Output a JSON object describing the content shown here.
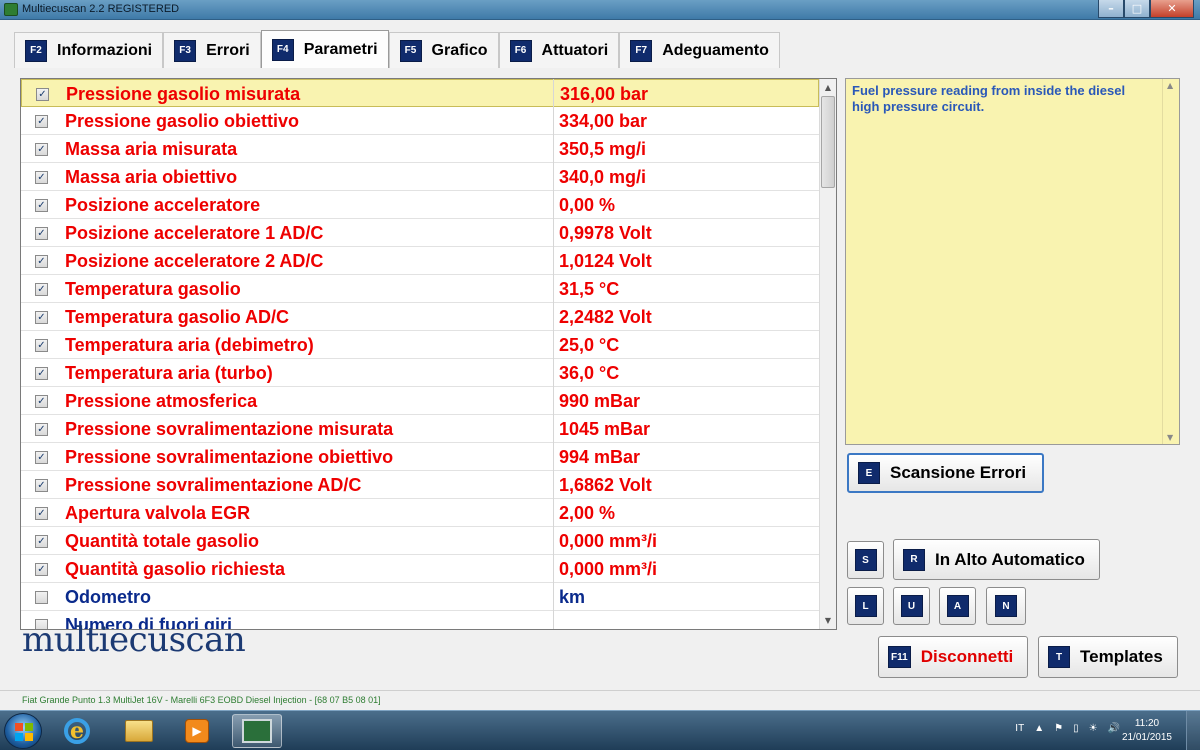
{
  "window": {
    "title": "Multiecuscan 2.2 REGISTERED",
    "controls": {
      "minimize": "–",
      "maximize": "□",
      "close": "✕"
    }
  },
  "tabs": [
    {
      "key": "F2",
      "label": "Informazioni"
    },
    {
      "key": "F3",
      "label": "Errori"
    },
    {
      "key": "F4",
      "label": "Parametri",
      "active": true
    },
    {
      "key": "F5",
      "label": "Grafico"
    },
    {
      "key": "F6",
      "label": "Attuatori"
    },
    {
      "key": "F7",
      "label": "Adeguamento"
    }
  ],
  "parameters": [
    {
      "name": "Pressione gasolio misurata",
      "value": "316,00 bar",
      "checked": true,
      "selected": true
    },
    {
      "name": "Pressione gasolio obiettivo",
      "value": "334,00 bar",
      "checked": true
    },
    {
      "name": "Massa aria misurata",
      "value": "350,5 mg/i",
      "checked": true
    },
    {
      "name": "Massa aria obiettivo",
      "value": "340,0 mg/i",
      "checked": true
    },
    {
      "name": "Posizione acceleratore",
      "value": "0,00 %",
      "checked": true
    },
    {
      "name": "Posizione acceleratore 1 AD/C",
      "value": "0,9978 Volt",
      "checked": true
    },
    {
      "name": "Posizione acceleratore 2 AD/C",
      "value": "1,0124 Volt",
      "checked": true
    },
    {
      "name": "Temperatura gasolio",
      "value": "31,5 °C",
      "checked": true
    },
    {
      "name": "Temperatura gasolio AD/C",
      "value": "2,2482 Volt",
      "checked": true
    },
    {
      "name": "Temperatura aria (debimetro)",
      "value": "25,0 °C",
      "checked": true
    },
    {
      "name": "Temperatura aria (turbo)",
      "value": "36,0 °C",
      "checked": true
    },
    {
      "name": "Pressione atmosferica",
      "value": "990 mBar",
      "checked": true
    },
    {
      "name": "Pressione sovralimentazione misurata",
      "value": "1045 mBar",
      "checked": true
    },
    {
      "name": "Pressione sovralimentazione obiettivo",
      "value": "994 mBar",
      "checked": true
    },
    {
      "name": "Pressione sovralimentazione AD/C",
      "value": "1,6862 Volt",
      "checked": true
    },
    {
      "name": "Apertura valvola EGR",
      "value": "2,00 %",
      "checked": true
    },
    {
      "name": "Quantità totale gasolio",
      "value": "0,000 mm³/i",
      "checked": true
    },
    {
      "name": "Quantità gasolio richiesta",
      "value": "0,000 mm³/i",
      "checked": true
    },
    {
      "name": "Odometro",
      "value": "km",
      "checked": false,
      "color": "blue"
    },
    {
      "name": "Numero di fuori giri",
      "value": "",
      "checked": false,
      "color": "blue"
    }
  ],
  "description": {
    "text": "Fuel pressure reading from inside the diesel high pressure circuit."
  },
  "buttons": {
    "scan_errors": {
      "key": "E",
      "label": "Scansione Errori"
    },
    "s": {
      "key": "S"
    },
    "auto_top": {
      "key": "R",
      "label": "In Alto Automatico"
    },
    "l": {
      "key": "L"
    },
    "u": {
      "key": "U"
    },
    "a": {
      "key": "A"
    },
    "n": {
      "key": "N"
    },
    "disconnect": {
      "key": "F11",
      "label": "Disconnetti"
    },
    "templates": {
      "key": "T",
      "label": "Templates"
    }
  },
  "logo": "multiecuscan",
  "status": "Fiat Grande Punto 1.3 MultiJet 16V - Marelli 6F3 EOBD Diesel Injection - [68 07 B5 08 01]",
  "taskbar": {
    "language": "IT",
    "time": "11:20",
    "date": "21/01/2015"
  },
  "colors": {
    "param_red": "#ee0000",
    "param_blue": "#0a2a8c",
    "selection_yellow": "#f9f3b0",
    "key_navy": "#102b6c",
    "logo_blue": "#1c3a73"
  }
}
